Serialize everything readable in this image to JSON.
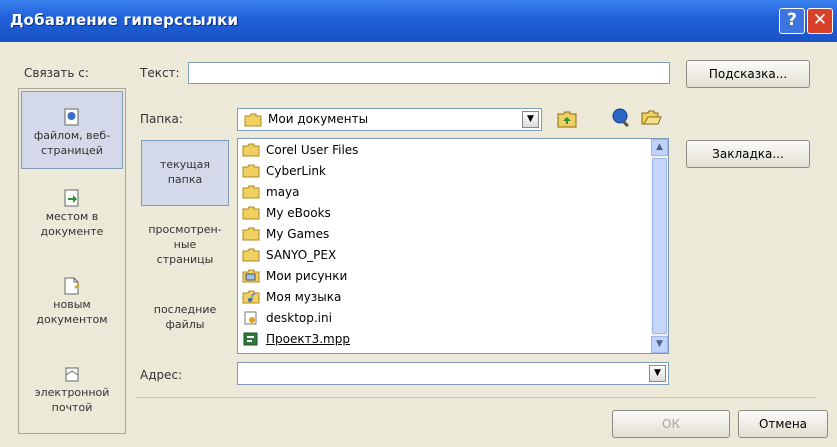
{
  "window": {
    "title": "Добавление гиперссылки",
    "help_label": "?",
    "close_label": "✕"
  },
  "link_to": {
    "label": "Связать с:",
    "items": [
      {
        "label_line1": "файлом, веб-",
        "label_line2": "страницей",
        "icon": "web-page-icon",
        "selected": true
      },
      {
        "label_line1": "местом в",
        "label_line2": "документе",
        "icon": "document-place-icon",
        "selected": false
      },
      {
        "label_line1": "новым",
        "label_line2": "документом",
        "icon": "new-document-icon",
        "selected": false
      },
      {
        "label_line1": "электронной",
        "label_line2": "почтой",
        "icon": "email-icon",
        "selected": false
      }
    ]
  },
  "text_field": {
    "label": "Текст:",
    "value": ""
  },
  "buttons": {
    "tooltip": "Подсказка...",
    "bookmark": "Закладка...",
    "ok": "ОК",
    "cancel": "Отмена"
  },
  "folder": {
    "label": "Папка:",
    "selected": "Мои документы",
    "arrow": "▼"
  },
  "look_in": {
    "items": [
      {
        "line1": "текущая",
        "line2": "папка",
        "line3": "",
        "selected": true
      },
      {
        "line1": "просмотрен-",
        "line2": "ные",
        "line3": "страницы",
        "selected": false
      },
      {
        "line1": "последние",
        "line2": "файлы",
        "line3": "",
        "selected": false
      }
    ]
  },
  "files": [
    {
      "name": "Corel User Files",
      "icon": "folder-icon"
    },
    {
      "name": "CyberLink",
      "icon": "folder-icon"
    },
    {
      "name": "maya",
      "icon": "folder-icon"
    },
    {
      "name": "My eBooks",
      "icon": "folder-icon"
    },
    {
      "name": "My Games",
      "icon": "folder-icon"
    },
    {
      "name": "SANYO_PEX",
      "icon": "folder-icon"
    },
    {
      "name": "Мои рисунки",
      "icon": "pictures-folder-icon"
    },
    {
      "name": "Моя музыка",
      "icon": "music-folder-icon"
    },
    {
      "name": "desktop.ini",
      "icon": "settings-file-icon"
    },
    {
      "name": "Проект3.mpp",
      "icon": "project-file-icon"
    }
  ],
  "scroll": {
    "up": "▲",
    "down": "▼"
  },
  "address": {
    "label": "Адрес:",
    "value": "",
    "arrow": "▼"
  },
  "colors": {
    "titlebar": "#1f5fd8",
    "folder": "#f0d060",
    "background": "#ece9d8",
    "selection": "#d3d9e8"
  }
}
